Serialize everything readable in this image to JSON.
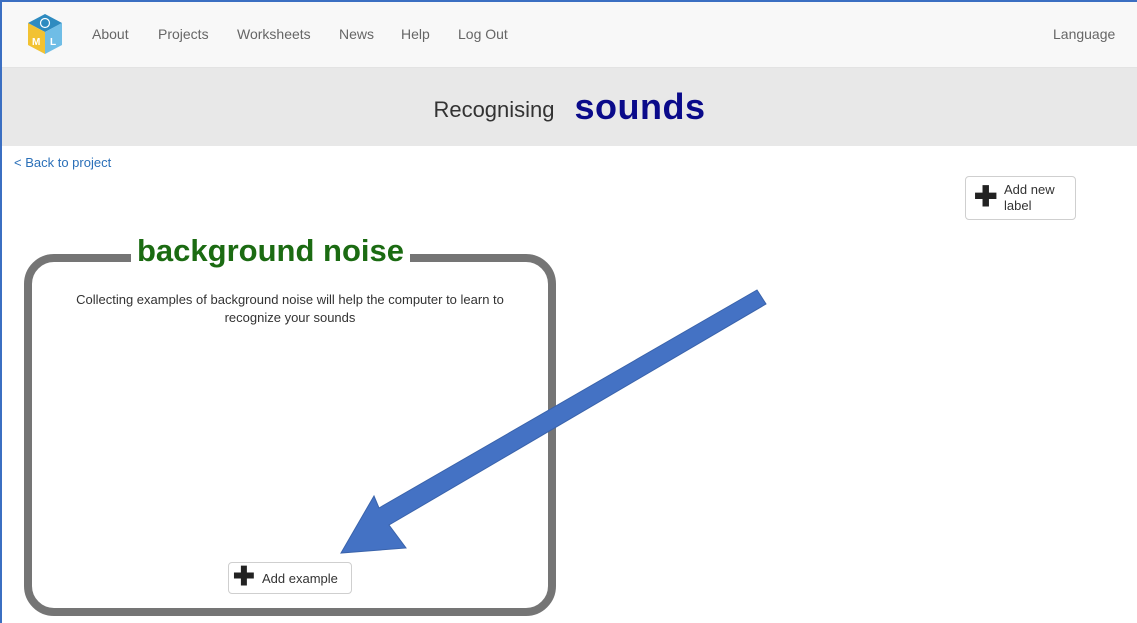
{
  "nav": {
    "items": [
      {
        "label": "About"
      },
      {
        "label": "Projects"
      },
      {
        "label": "Worksheets"
      },
      {
        "label": "News"
      },
      {
        "label": "Help"
      },
      {
        "label": "Log Out"
      }
    ],
    "language_label": "Language"
  },
  "banner": {
    "prefix": "Recognising",
    "word": "sounds"
  },
  "back_link": "< Back to project",
  "add_label_button": {
    "text": "Add new label"
  },
  "label_card": {
    "title": "background noise",
    "description": "Collecting examples of background noise will help the computer to learn to recognize your sounds",
    "add_example_label": "Add example"
  },
  "colors": {
    "accent_blue": "#3b6fc2",
    "banner_word": "#0a0a8a",
    "card_title": "#1b6b12",
    "card_border": "#757575",
    "annotation_arrow": "#4472c4"
  },
  "icons": [
    "ml4k-logo-icon",
    "plus-icon",
    "annotation-arrow"
  ]
}
